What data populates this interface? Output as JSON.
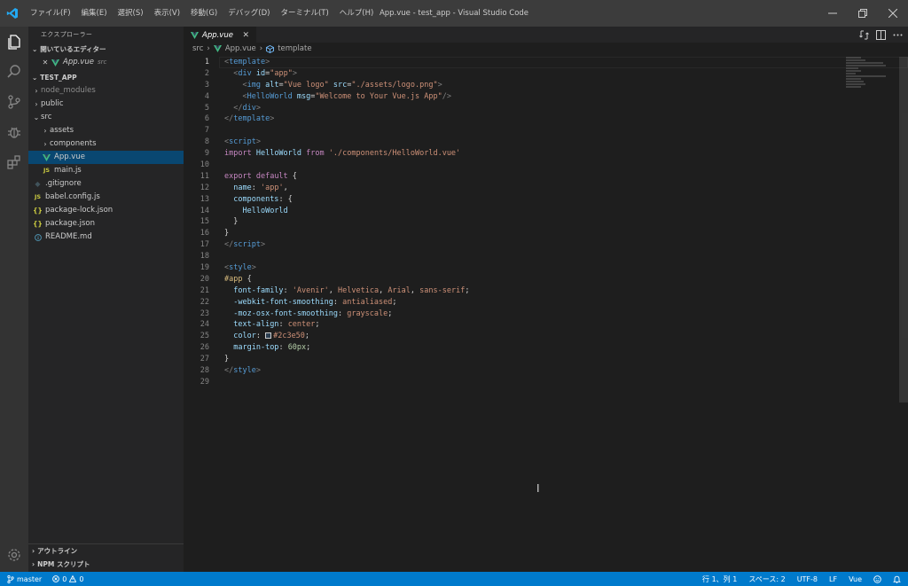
{
  "titlebar": {
    "menu": [
      "ファイル(F)",
      "編集(E)",
      "選択(S)",
      "表示(V)",
      "移動(G)",
      "デバッグ(D)",
      "ターミナル(T)",
      "ヘルプ(H)"
    ],
    "window_title": "App.vue - test_app - Visual Studio Code",
    "accent_color": "#23a9f2"
  },
  "sidebar": {
    "title": "エクスプローラー",
    "open_editors": {
      "header": "開いているエディター",
      "items": [
        {
          "name": "App.vue",
          "hint": "src"
        }
      ]
    },
    "project": {
      "header": "TEST_APP",
      "tree": [
        {
          "label": "node_modules",
          "kind": "folder",
          "depth": 1,
          "expanded": false
        },
        {
          "label": "public",
          "kind": "folder",
          "depth": 1,
          "expanded": false
        },
        {
          "label": "src",
          "kind": "folder",
          "depth": 1,
          "expanded": true
        },
        {
          "label": "assets",
          "kind": "folder",
          "depth": 2,
          "expanded": false
        },
        {
          "label": "components",
          "kind": "folder",
          "depth": 2,
          "expanded": false
        },
        {
          "label": "App.vue",
          "kind": "vue",
          "depth": 2
        },
        {
          "label": "main.js",
          "kind": "js",
          "depth": 2
        },
        {
          "label": ".gitignore",
          "kind": "git",
          "depth": 1
        },
        {
          "label": "babel.config.js",
          "kind": "js",
          "depth": 1
        },
        {
          "label": "package-lock.json",
          "kind": "json",
          "depth": 1
        },
        {
          "label": "package.json",
          "kind": "json",
          "depth": 1
        },
        {
          "label": "README.md",
          "kind": "info",
          "depth": 1
        }
      ]
    },
    "outline_header": "アウトライン",
    "npm_header": "NPM スクリプト"
  },
  "editor": {
    "tab": {
      "label": "App.vue"
    },
    "breadcrumb": [
      "src",
      "App.vue",
      "template"
    ],
    "current_line": 1,
    "lines": [
      [
        [
          "t-punct",
          "<"
        ],
        [
          "t-tag",
          "template"
        ],
        [
          "t-punct",
          ">"
        ]
      ],
      [
        [
          "t-plain",
          "  "
        ],
        [
          "t-punct",
          "<"
        ],
        [
          "t-tag",
          "div"
        ],
        [
          "t-plain",
          " "
        ],
        [
          "t-attr",
          "id"
        ],
        [
          "t-plain",
          "="
        ],
        [
          "t-str",
          "\"app\""
        ],
        [
          "t-punct",
          ">"
        ]
      ],
      [
        [
          "t-plain",
          "    "
        ],
        [
          "t-punct",
          "<"
        ],
        [
          "t-tag",
          "img"
        ],
        [
          "t-plain",
          " "
        ],
        [
          "t-attr",
          "alt"
        ],
        [
          "t-plain",
          "="
        ],
        [
          "t-str",
          "\"Vue logo\""
        ],
        [
          "t-plain",
          " "
        ],
        [
          "t-attr",
          "src"
        ],
        [
          "t-plain",
          "="
        ],
        [
          "t-str",
          "\"./assets/logo.png\""
        ],
        [
          "t-punct",
          ">"
        ]
      ],
      [
        [
          "t-plain",
          "    "
        ],
        [
          "t-punct",
          "<"
        ],
        [
          "t-tag",
          "HelloWorld"
        ],
        [
          "t-plain",
          " "
        ],
        [
          "t-attr",
          "msg"
        ],
        [
          "t-plain",
          "="
        ],
        [
          "t-str",
          "\"Welcome to Your Vue.js App\""
        ],
        [
          "t-punct",
          "/>"
        ]
      ],
      [
        [
          "t-plain",
          "  "
        ],
        [
          "t-punct",
          "</"
        ],
        [
          "t-tag",
          "div"
        ],
        [
          "t-punct",
          ">"
        ]
      ],
      [
        [
          "t-punct",
          "</"
        ],
        [
          "t-tag",
          "template"
        ],
        [
          "t-punct",
          ">"
        ]
      ],
      [],
      [
        [
          "t-punct",
          "<"
        ],
        [
          "t-tag",
          "script"
        ],
        [
          "t-punct",
          ">"
        ]
      ],
      [
        [
          "t-kw",
          "import"
        ],
        [
          "t-plain",
          " "
        ],
        [
          "t-id",
          "HelloWorld"
        ],
        [
          "t-plain",
          " "
        ],
        [
          "t-kw",
          "from"
        ],
        [
          "t-plain",
          " "
        ],
        [
          "t-str",
          "'./components/HelloWorld.vue'"
        ]
      ],
      [],
      [
        [
          "t-kw",
          "export"
        ],
        [
          "t-plain",
          " "
        ],
        [
          "t-kw",
          "default"
        ],
        [
          "t-plain",
          " {"
        ]
      ],
      [
        [
          "t-plain",
          "  "
        ],
        [
          "t-id",
          "name"
        ],
        [
          "t-plain",
          ": "
        ],
        [
          "t-str",
          "'app'"
        ],
        [
          "t-plain",
          ","
        ]
      ],
      [
        [
          "t-plain",
          "  "
        ],
        [
          "t-id",
          "components"
        ],
        [
          "t-plain",
          ": {"
        ]
      ],
      [
        [
          "t-plain",
          "    "
        ],
        [
          "t-id",
          "HelloWorld"
        ]
      ],
      [
        [
          "t-plain",
          "  }"
        ]
      ],
      [
        [
          "t-plain",
          "}"
        ]
      ],
      [
        [
          "t-punct",
          "</"
        ],
        [
          "t-tag",
          "script"
        ],
        [
          "t-punct",
          ">"
        ]
      ],
      [],
      [
        [
          "t-punct",
          "<"
        ],
        [
          "t-tag",
          "style"
        ],
        [
          "t-punct",
          ">"
        ]
      ],
      [
        [
          "t-sel",
          "#app"
        ],
        [
          "t-plain",
          " {"
        ]
      ],
      [
        [
          "t-plain",
          "  "
        ],
        [
          "t-prop",
          "font-family"
        ],
        [
          "t-plain",
          ": "
        ],
        [
          "t-val",
          "'Avenir'"
        ],
        [
          "t-plain",
          ", "
        ],
        [
          "t-val",
          "Helvetica"
        ],
        [
          "t-plain",
          ", "
        ],
        [
          "t-val",
          "Arial"
        ],
        [
          "t-plain",
          ", "
        ],
        [
          "t-val",
          "sans-serif"
        ],
        [
          "t-plain",
          ";"
        ]
      ],
      [
        [
          "t-plain",
          "  "
        ],
        [
          "t-prop",
          "-webkit-font-smoothing"
        ],
        [
          "t-plain",
          ": "
        ],
        [
          "t-val",
          "antialiased"
        ],
        [
          "t-plain",
          ";"
        ]
      ],
      [
        [
          "t-plain",
          "  "
        ],
        [
          "t-prop",
          "-moz-osx-font-smoothing"
        ],
        [
          "t-plain",
          ": "
        ],
        [
          "t-val",
          "grayscale"
        ],
        [
          "t-plain",
          ";"
        ]
      ],
      [
        [
          "t-plain",
          "  "
        ],
        [
          "t-prop",
          "text-align"
        ],
        [
          "t-plain",
          ": "
        ],
        [
          "t-val",
          "center"
        ],
        [
          "t-plain",
          ";"
        ]
      ],
      [
        [
          "t-plain",
          "  "
        ],
        [
          "t-prop",
          "color"
        ],
        [
          "t-plain",
          ": "
        ],
        [
          "swatch",
          ""
        ],
        [
          "t-val",
          "#2c3e50"
        ],
        [
          "t-plain",
          ";"
        ]
      ],
      [
        [
          "t-plain",
          "  "
        ],
        [
          "t-prop",
          "margin-top"
        ],
        [
          "t-plain",
          ": "
        ],
        [
          "t-num",
          "60px"
        ],
        [
          "t-plain",
          ";"
        ]
      ],
      [
        [
          "t-plain",
          "}"
        ]
      ],
      [
        [
          "t-punct",
          "</"
        ],
        [
          "t-tag",
          "style"
        ],
        [
          "t-punct",
          ">"
        ]
      ],
      []
    ]
  },
  "statusbar": {
    "branch": "master",
    "errors": "0",
    "warnings": "0",
    "position": "行 1、列 1",
    "spaces": "スペース: 2",
    "encoding": "UTF-8",
    "eol": "LF",
    "language": "Vue",
    "color": "#007acc"
  }
}
